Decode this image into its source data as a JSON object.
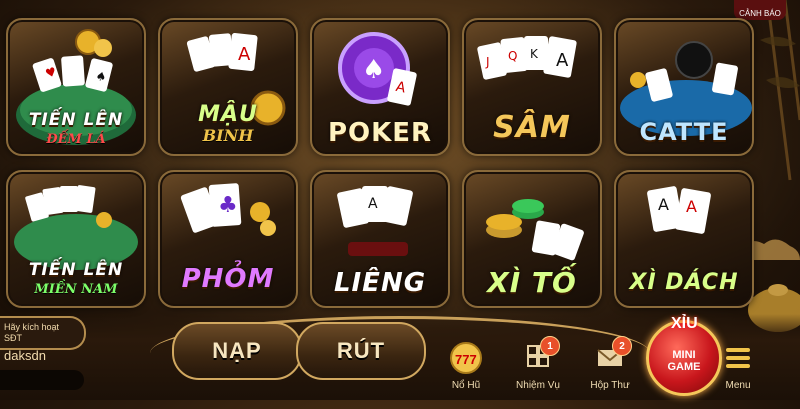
{
  "games": [
    {
      "id": "tien-len-dem-la",
      "title": "TIẾN LÊN",
      "subtitle": "ĐẾM LÁ"
    },
    {
      "id": "mau-binh",
      "title": "MẬU",
      "subtitle": "BINH"
    },
    {
      "id": "poker",
      "title": "POKER",
      "subtitle": ""
    },
    {
      "id": "sam",
      "title": "SÂM",
      "subtitle": ""
    },
    {
      "id": "catte",
      "title": "CATTE",
      "subtitle": ""
    },
    {
      "id": "tien-len-mien-nam",
      "title": "TIẾN LÊN",
      "subtitle": "MIỀN NAM"
    },
    {
      "id": "phom",
      "title": "PHỎM",
      "subtitle": ""
    },
    {
      "id": "lieng",
      "title": "LIÊNG",
      "subtitle": ""
    },
    {
      "id": "xi-to",
      "title": "XÌ TỐ",
      "subtitle": ""
    },
    {
      "id": "xi-dach",
      "title": "XÌ DÁCH",
      "subtitle": ""
    }
  ],
  "warning": {
    "label": "CẢNH BÁO"
  },
  "profile": {
    "activate_line1": "Hãy kích hoạt",
    "activate_line2": "SĐT",
    "username": "daksdn"
  },
  "actions": {
    "deposit": "NẠP",
    "withdraw": "RÚT"
  },
  "nav": [
    {
      "label": "Nổ Hũ",
      "icon": "jackpot-777-icon",
      "badge": ""
    },
    {
      "label": "Nhiệm Vụ",
      "icon": "missions-icon",
      "badge": "1"
    },
    {
      "label": "Hộp Thư",
      "icon": "mail-icon",
      "badge": "2"
    },
    {
      "label": "Menu",
      "icon": "menu-icon",
      "badge": ""
    }
  ],
  "mini_game": {
    "top": "XỈU",
    "line1": "MINI",
    "line2": "GAME"
  },
  "colors": {
    "gold": "#f5c75a",
    "brown_dark": "#1b1007",
    "accent_red": "#e8502a"
  }
}
